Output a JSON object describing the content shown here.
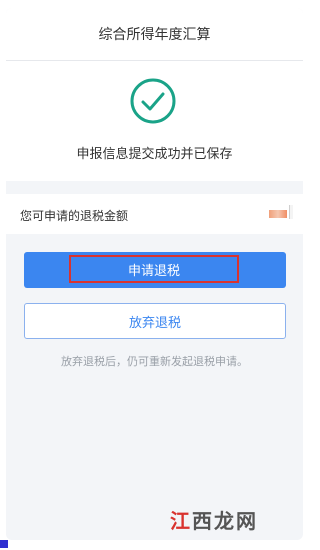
{
  "header": {
    "title": "综合所得年度汇算"
  },
  "status": {
    "message": "申报信息提交成功并已保存",
    "icon": "check-circle-icon",
    "color": "#1aa388"
  },
  "refund": {
    "label": "您可申请的退税金额",
    "amount_hidden": true
  },
  "actions": {
    "apply_label": "申请退税",
    "giveup_label": "放弃退税"
  },
  "hint": "放弃退税后，仍可重新发起退税申请。",
  "watermark": {
    "chars": [
      "江",
      "西",
      "龙",
      "网"
    ]
  },
  "colors": {
    "primary": "#3b86f0",
    "highlight": "#d9332f",
    "success": "#1aa388"
  }
}
